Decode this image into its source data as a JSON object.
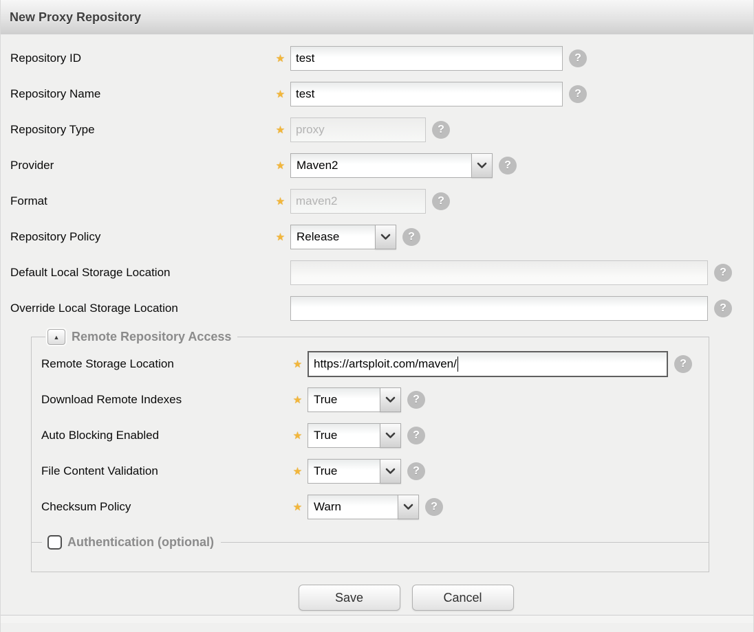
{
  "header": {
    "title": "New Proxy Repository"
  },
  "icons": {
    "help": "?",
    "star": "★",
    "collapse_up": "▲"
  },
  "form": {
    "fields": {
      "repository_id": {
        "label": "Repository ID",
        "value": "test"
      },
      "repository_name": {
        "label": "Repository Name",
        "value": "test"
      },
      "repository_type": {
        "label": "Repository Type",
        "value": "proxy"
      },
      "provider": {
        "label": "Provider",
        "value": "Maven2"
      },
      "format": {
        "label": "Format",
        "value": "maven2"
      },
      "repository_policy": {
        "label": "Repository Policy",
        "value": "Release"
      },
      "default_local_storage": {
        "label": "Default Local Storage Location",
        "value": ""
      },
      "override_local_storage": {
        "label": "Override Local Storage Location",
        "value": ""
      }
    },
    "remote_access": {
      "legend": "Remote Repository Access",
      "fields": {
        "remote_storage_location": {
          "label": "Remote Storage Location",
          "value": "https://artsploit.com/maven/"
        },
        "download_remote_indexes": {
          "label": "Download Remote Indexes",
          "value": "True"
        },
        "auto_blocking_enabled": {
          "label": "Auto Blocking Enabled",
          "value": "True"
        },
        "file_content_validation": {
          "label": "File Content Validation",
          "value": "True"
        },
        "checksum_policy": {
          "label": "Checksum Policy",
          "value": "Warn"
        }
      },
      "authentication": {
        "legend": "Authentication (optional)",
        "checked": false
      }
    },
    "buttons": {
      "save": "Save",
      "cancel": "Cancel"
    }
  }
}
